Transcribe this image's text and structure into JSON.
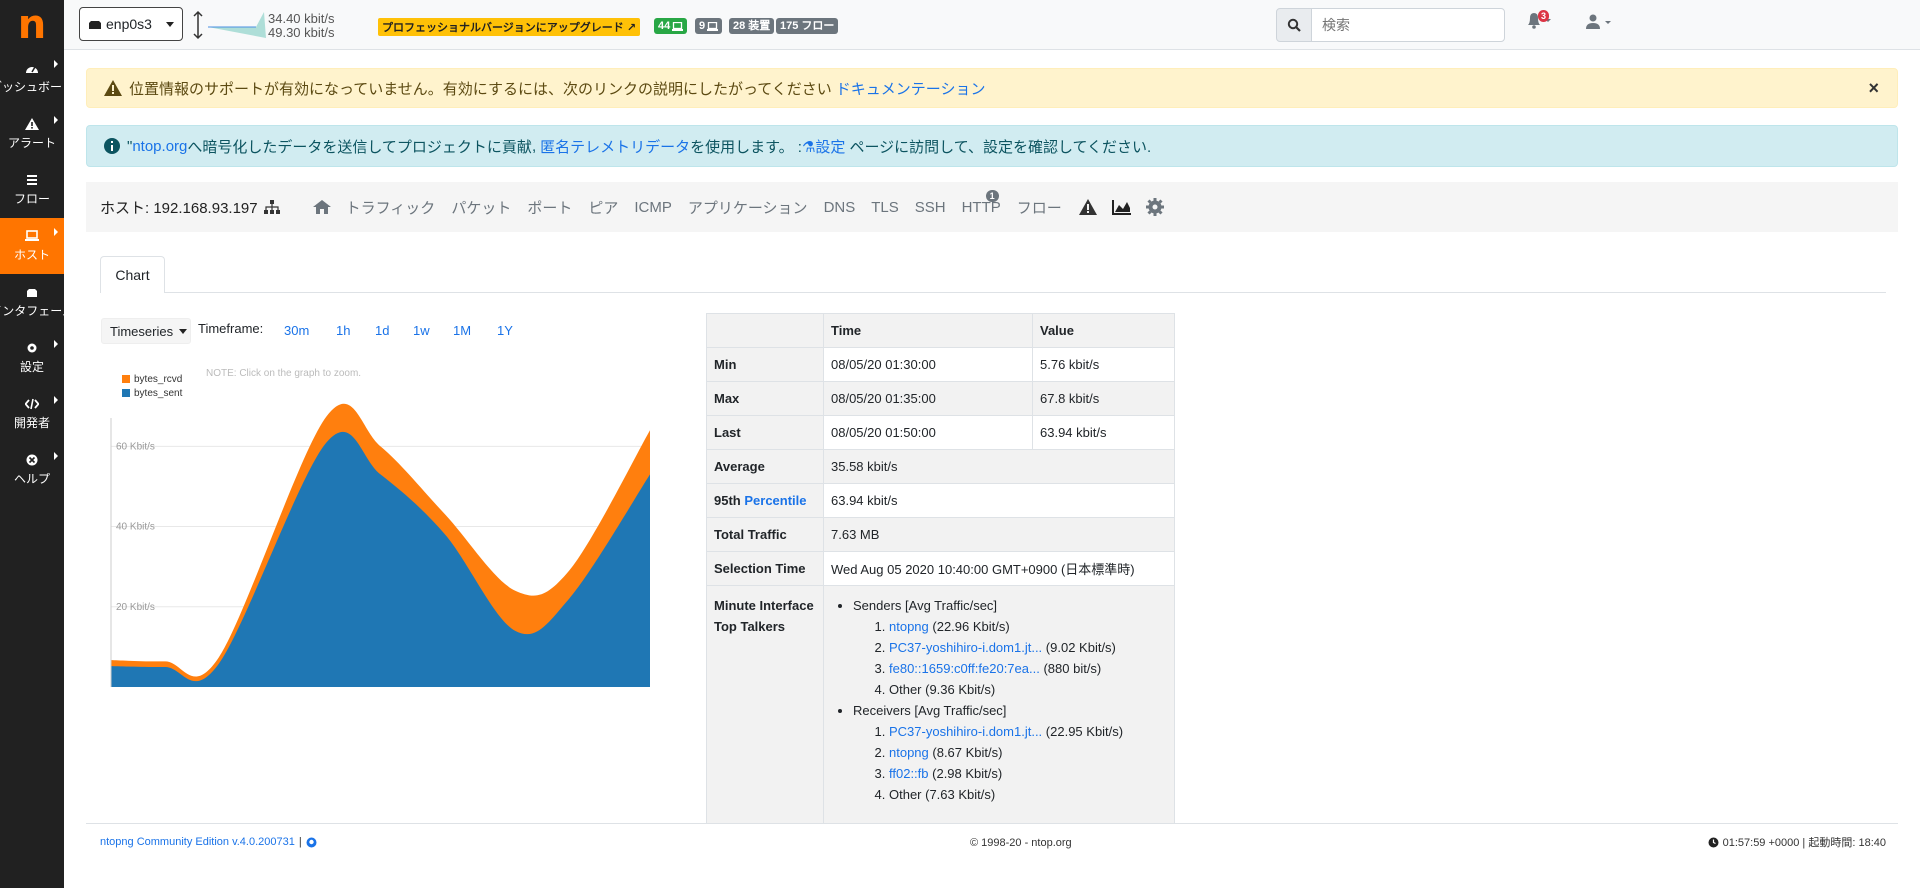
{
  "app": {
    "logo": "n"
  },
  "sidebar": {
    "items": [
      {
        "label": "ダッシュボード"
      },
      {
        "label": "アラート"
      },
      {
        "label": "フロー"
      },
      {
        "label": "ホスト"
      },
      {
        "label": "インタフェース"
      },
      {
        "label": "設定"
      },
      {
        "label": "開発者"
      },
      {
        "label": "ヘルプ"
      }
    ]
  },
  "topbar": {
    "interface": "enp0s3",
    "rate_up": "34.40 kbit/s",
    "rate_down": "49.30 kbit/s",
    "upgrade": "プロフェッショナルバージョンにアップグレード",
    "badges": {
      "hosts": "44",
      "local": "9",
      "devices": "28 装置",
      "flows": "175 フロー"
    },
    "search_placeholder": "検索",
    "notifications": "3",
    "colors": {
      "green": "#28a745",
      "gray": "#6c757d",
      "upgrade": "#ffc107"
    }
  },
  "alerts": {
    "warning_text": "位置情報のサポートが有効になっていません。有効にするには、次のリンクの説明にしたがってください",
    "warning_link": "ドキュメンテーション",
    "info_prefix": "\"",
    "info_link1": "ntop.org",
    "info_mid1": "へ暗号化したデータを送信してプロジェクトに貢献",
    "info_comma": ",",
    "info_link2": "匿名テレメトリデータ",
    "info_mid2": "を使用します。 :",
    "info_link3": "設定",
    "info_tail": "ページに訪問して、設定を確認してください."
  },
  "hostnav": {
    "host_label": "ホスト: 192.168.93.197",
    "items": [
      "トラフィック",
      "パケット",
      "ポート",
      "ピア",
      "ICMP",
      "アプリケーション",
      "DNS",
      "TLS",
      "SSH",
      "HTTP",
      "フロー"
    ],
    "http_badge": "1"
  },
  "tabs": {
    "chart": "Chart"
  },
  "controls": {
    "timeseries": "Timeseries",
    "timeframe_label": "Timeframe:",
    "timeframes": [
      "30m",
      "1h",
      "1d",
      "1w",
      "1M",
      "1Y"
    ]
  },
  "chart_data": {
    "type": "area",
    "note": "NOTE: Click on the graph to zoom.",
    "legend": [
      "bytes_rcvd",
      "bytes_sent"
    ],
    "y_ticks": [
      "20 Kbit/s",
      "40 Kbit/s",
      "60 Kbit/s"
    ],
    "ylim": [
      0,
      70
    ],
    "x": [
      0,
      0.1,
      0.2,
      0.4,
      0.5,
      0.62,
      0.75,
      0.85,
      1.0
    ],
    "series": [
      {
        "name": "bytes_sent",
        "color": "#1f77b4",
        "values": [
          5.2,
          5.0,
          5.8,
          61,
          53,
          38,
          14,
          22,
          53
        ]
      },
      {
        "name": "bytes_rcvd",
        "color": "#ff7f0e",
        "values": [
          1.5,
          1.4,
          1.6,
          6.5,
          7.0,
          5.0,
          10.0,
          7.0,
          11.0
        ]
      }
    ]
  },
  "stats": {
    "headers": [
      "",
      "Time",
      "Value"
    ],
    "rows": [
      {
        "label": "Min",
        "time": "08/05/20 01:30:00",
        "value": "5.76 kbit/s"
      },
      {
        "label": "Max",
        "time": "08/05/20 01:35:00",
        "value": "67.8 kbit/s"
      },
      {
        "label": "Last",
        "time": "08/05/20 01:50:00",
        "value": "63.94 kbit/s"
      }
    ],
    "average_label": "Average",
    "average": "35.58 kbit/s",
    "p95_label": "95th",
    "p95_link": "Percentile",
    "p95": "63.94 kbit/s",
    "total_label": "Total Traffic",
    "total": "7.63 MB",
    "selection_label": "Selection Time",
    "selection": "Wed Aug 05 2020 10:40:00 GMT+0900 (日本標準時)",
    "talkers_label": "Minute Interface Top Talkers",
    "senders_title": "Senders [Avg Traffic/sec]",
    "senders": [
      {
        "name": "ntopng",
        "value": "(22.96 Kbit/s)"
      },
      {
        "name": "PC37-yoshihiro-i.dom1.jt...",
        "value": "(9.02 Kbit/s)"
      },
      {
        "name": "fe80::1659:c0ff:fe20:7ea...",
        "value": "(880 bit/s)"
      },
      {
        "name": "",
        "value": "Other (9.36 Kbit/s)"
      }
    ],
    "receivers_title": "Receivers [Avg Traffic/sec]",
    "receivers": [
      {
        "name": "PC37-yoshihiro-i.dom1.jt...",
        "value": "(22.95 Kbit/s)"
      },
      {
        "name": "ntopng",
        "value": "(8.67 Kbit/s)"
      },
      {
        "name": "ff02::fb",
        "value": "(2.98 Kbit/s)"
      },
      {
        "name": "",
        "value": "Other (7.63 Kbit/s)"
      }
    ]
  },
  "footer": {
    "edition": "ntopng Community Edition v.4.0.200731",
    "sep": "|",
    "copyright": "© 1998-20 - ntop.org",
    "time": "01:57:59 +0000 | 起動時間: 18:40"
  }
}
